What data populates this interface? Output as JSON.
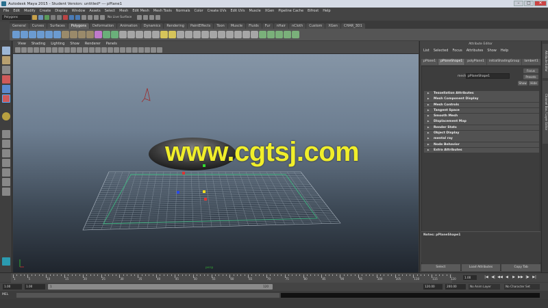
{
  "window": {
    "title": "Autodesk Maya 2015 - Student Version: untitled*  ---  pPlane1",
    "controls": [
      "–",
      "□",
      "✕"
    ]
  },
  "menubar": [
    "File",
    "Edit",
    "Modify",
    "Create",
    "Display",
    "Window",
    "Assets",
    "Select",
    "Mesh",
    "Edit Mesh",
    "Mesh Tools",
    "Normals",
    "Color",
    "Create UVs",
    "Edit UVs",
    "Muscle",
    "XGen",
    "Pipeline Cache",
    "Bifrost",
    "Help"
  ],
  "statusline": {
    "menuset": "Polygons",
    "live_surface": "No Live Surface"
  },
  "shelf": {
    "tabs": [
      "General",
      "Curves",
      "Surfaces",
      "Polygons",
      "Deformation",
      "Animation",
      "Dynamics",
      "Rendering",
      "PaintEffects",
      "Toon",
      "Muscle",
      "Fluids",
      "Fur",
      "nHair",
      "nCloth",
      "Custom",
      "XGen",
      "CHAR_3D1"
    ],
    "active_tab": "Polygons"
  },
  "viewport": {
    "menu": [
      "View",
      "Shading",
      "Lighting",
      "Show",
      "Renderer",
      "Panels"
    ],
    "camera_label": "persp",
    "watermark": "www.cgtsj.com"
  },
  "attribute_editor": {
    "title": "Attribute Editor",
    "menu": [
      "List",
      "Selected",
      "Focus",
      "Attributes",
      "Show",
      "Help"
    ],
    "tabs": [
      "pPlane1",
      "pPlaneShape1",
      "polyPlane1",
      "initialShadingGroup",
      "lambert1"
    ],
    "active_tab": "pPlaneShape1",
    "mesh_label": "mesh:",
    "mesh_value": "pPlaneShape1",
    "buttons": {
      "focus": "Focus",
      "presets": "Presets",
      "show": "Show",
      "hide": "Hide"
    },
    "sections": [
      "Tessellation Attributes",
      "Mesh Component Display",
      "Mesh Controls",
      "Tangent Space",
      "Smooth Mesh",
      "Displacement Map",
      "Render Stats",
      "Object Display",
      "mental ray",
      "Node Behavior",
      "Extra Attributes"
    ],
    "notes_label": "Notes: pPlaneShape1",
    "bottom_buttons": [
      "Select",
      "Load Attributes",
      "Copy Tab"
    ]
  },
  "side_tabs": [
    "Attribute Editor",
    "Channel Box / Layer Editor"
  ],
  "time_slider": {
    "tick_labels": [
      "1",
      "5",
      "10",
      "15",
      "20",
      "25",
      "30",
      "35",
      "40",
      "45",
      "50",
      "55",
      "60",
      "65",
      "70",
      "75",
      "80",
      "85",
      "90",
      "95",
      "100",
      "105",
      "110",
      "115",
      "120"
    ],
    "current_frame": "1.00",
    "playback": [
      "|◀",
      "◀|",
      "◀◀",
      "◀",
      "▶",
      "▶▶",
      "|▶",
      "▶|"
    ]
  },
  "range_slider": {
    "start": "1.00",
    "playback_start": "1.00",
    "range_left": "1",
    "range_right": "120",
    "playback_end": "120.00",
    "end": "200.00",
    "anim_layer": "No Anim Layer",
    "character_set": "No Character Set"
  },
  "command_line": {
    "label": "MEL"
  },
  "colors": {
    "accent_green": "#3ec486",
    "selection_cyan": "#57d1ff",
    "watermark_yellow": "#f0ee2a"
  }
}
